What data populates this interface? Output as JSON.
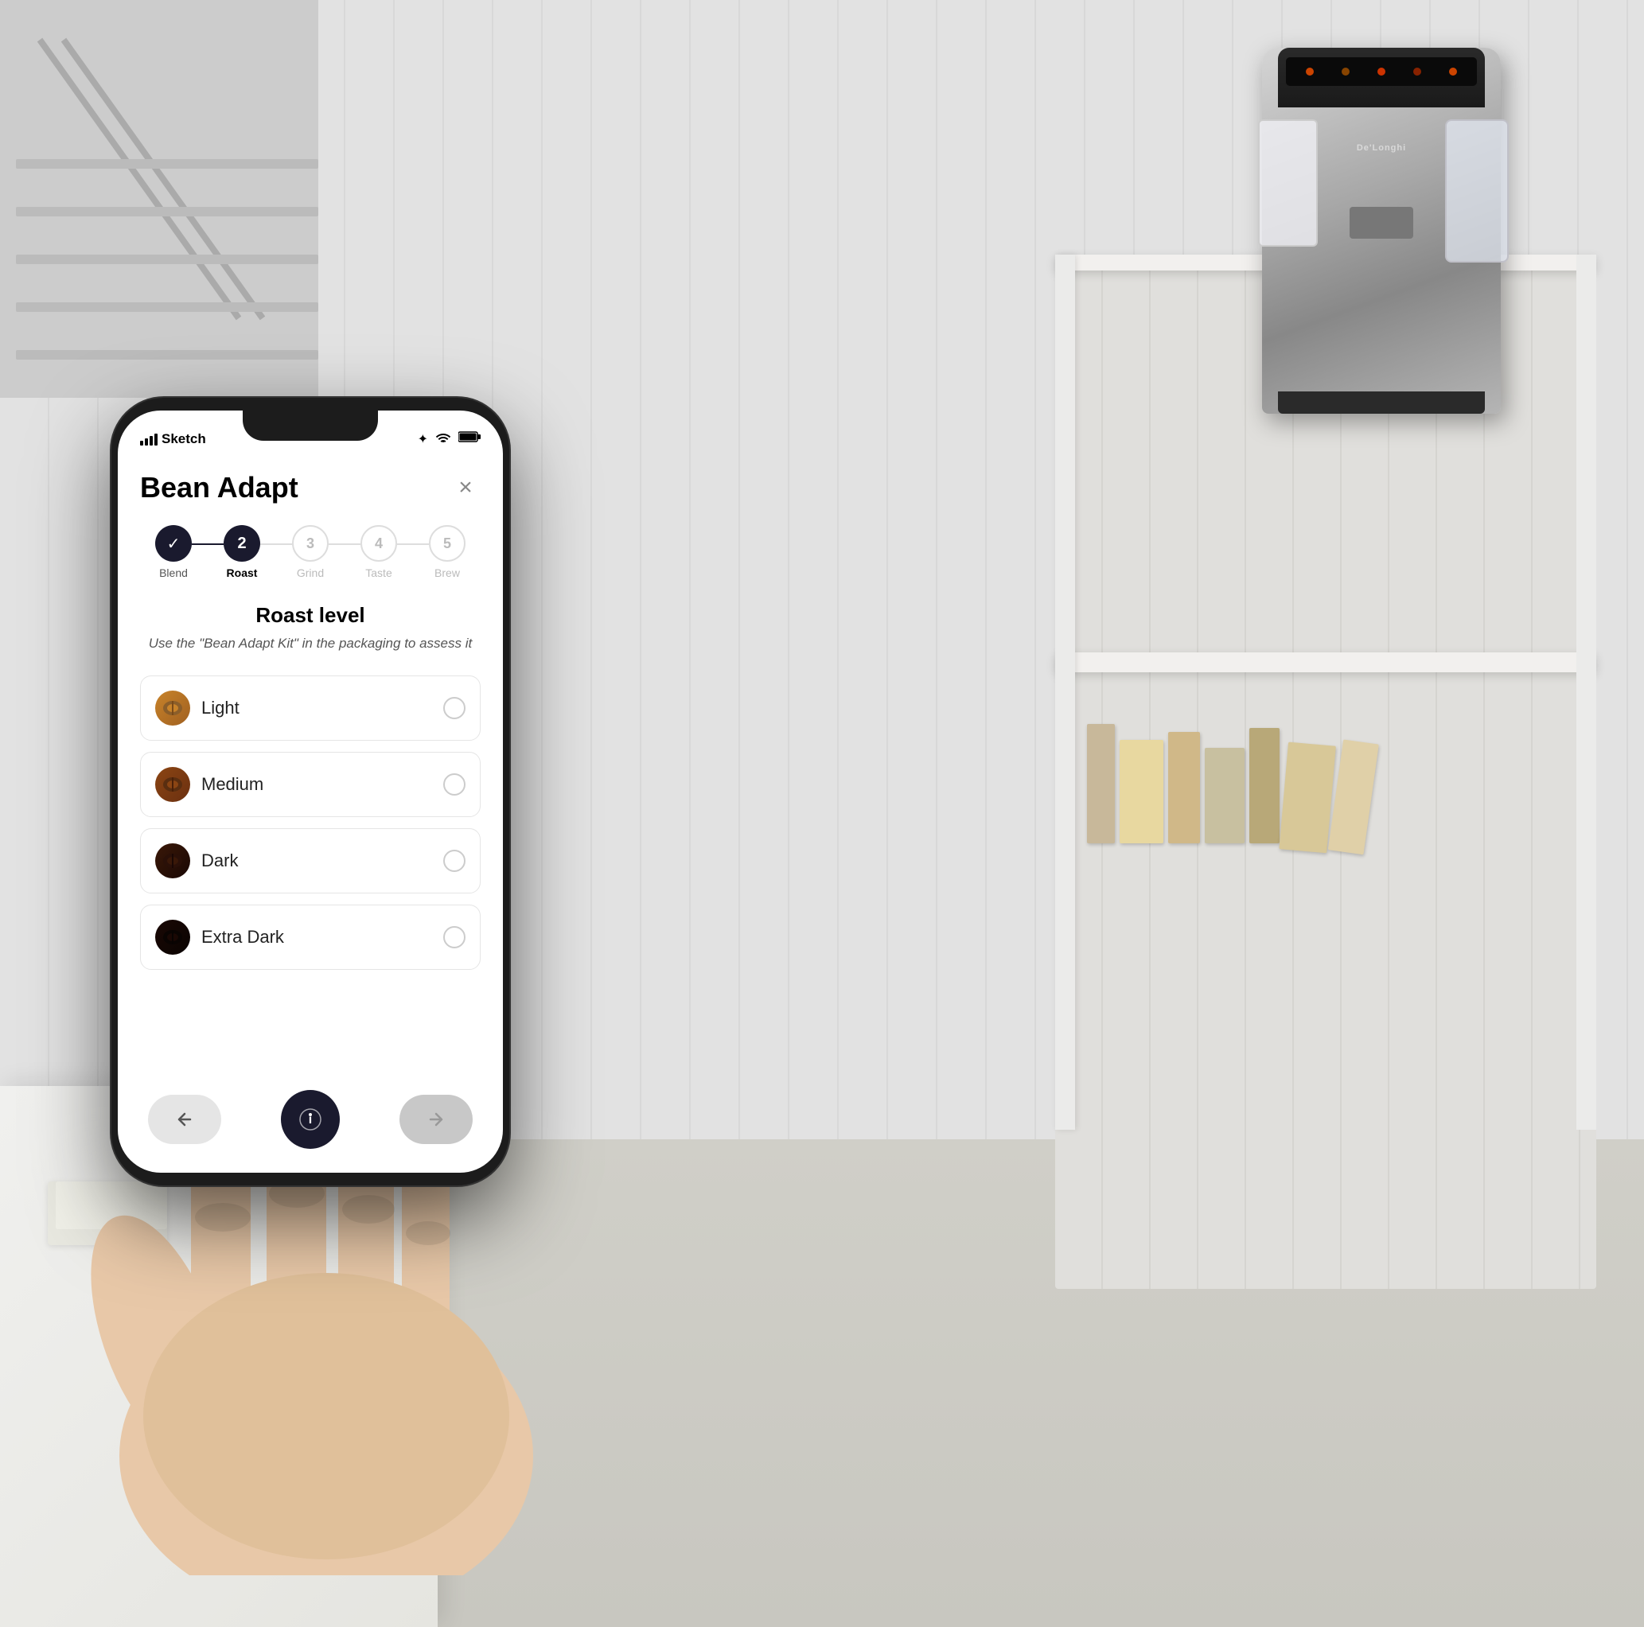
{
  "scene": {
    "background_color": "#d5d3ce"
  },
  "phone": {
    "status_bar": {
      "carrier": "Sketch",
      "signal_label": "Sketch",
      "time": "",
      "battery_icon": "battery",
      "wifi_icon": "wifi",
      "bluetooth_icon": "bluetooth"
    },
    "app": {
      "title": "Bean Adapt",
      "close_label": "×",
      "steps": [
        {
          "number": "✓",
          "label": "Blend",
          "state": "completed"
        },
        {
          "number": "2",
          "label": "Roast",
          "state": "active"
        },
        {
          "number": "3",
          "label": "Grind",
          "state": "inactive"
        },
        {
          "number": "4",
          "label": "Taste",
          "state": "inactive"
        },
        {
          "number": "5",
          "label": "Brew",
          "state": "inactive"
        }
      ],
      "section_title": "Roast level",
      "section_subtitle": "Use the \"Bean Adapt Kit\" in the packaging to assess it",
      "roast_options": [
        {
          "id": "light",
          "name": "Light",
          "icon": "☕",
          "selected": false
        },
        {
          "id": "medium",
          "name": "Medium",
          "icon": "☕",
          "selected": false
        },
        {
          "id": "dark",
          "name": "Dark",
          "icon": "☕",
          "selected": false
        },
        {
          "id": "extra-dark",
          "name": "Extra Dark",
          "icon": "☕",
          "selected": false
        }
      ],
      "nav": {
        "back_label": "←",
        "info_label": "ℹ",
        "next_label": "→"
      }
    }
  },
  "books": [
    {
      "color": "#c8b89a",
      "width": 30,
      "height": 130
    },
    {
      "color": "#e8d8b0",
      "width": 50,
      "height": 120
    },
    {
      "color": "#d0c090",
      "width": 40,
      "height": 115
    },
    {
      "color": "#b8a880",
      "width": 35,
      "height": 125
    },
    {
      "color": "#d8c8a0",
      "width": 45,
      "height": 118
    },
    {
      "color": "#c0b090",
      "width": 30,
      "height": 110
    }
  ]
}
